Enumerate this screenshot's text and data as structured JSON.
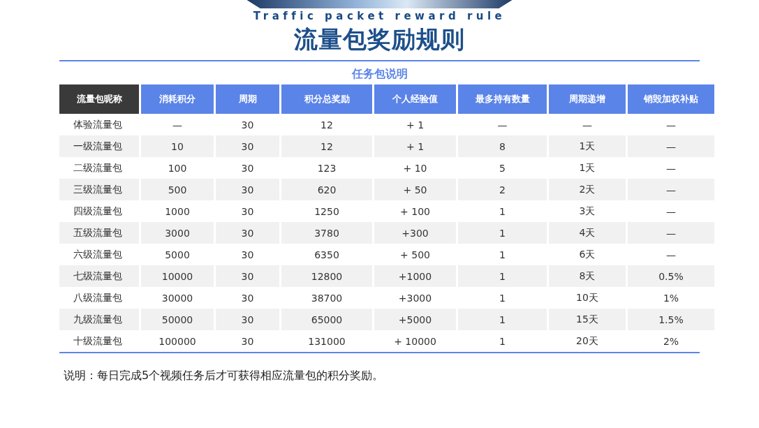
{
  "banner": {
    "subtitle": "Traffic packet reward rule",
    "title": "流量包奖励规则"
  },
  "section_title": "任务包说明",
  "table": {
    "columns": [
      {
        "label": "流量包昵称",
        "kind": "dark"
      },
      {
        "label": "消耗积分",
        "kind": "accent"
      },
      {
        "label": "周期",
        "kind": "accent"
      },
      {
        "label": "积分总奖励",
        "kind": "accent"
      },
      {
        "label": "个人经验值",
        "kind": "accent"
      },
      {
        "label": "最多持有数量",
        "kind": "accent"
      },
      {
        "label": "周期递增",
        "kind": "accent"
      },
      {
        "label": "销毁加权补贴",
        "kind": "accent"
      }
    ],
    "rows": [
      [
        "体验流量包",
        "—",
        "30",
        "12",
        "+ 1",
        "—",
        "—",
        "—"
      ],
      [
        "一级流量包",
        "10",
        "30",
        "12",
        "+ 1",
        "8",
        "1天",
        "—"
      ],
      [
        "二级流量包",
        "100",
        "30",
        "123",
        "+ 10",
        "5",
        "1天",
        "—"
      ],
      [
        "三级流量包",
        "500",
        "30",
        "620",
        "+ 50",
        "2",
        "2天",
        "—"
      ],
      [
        "四级流量包",
        "1000",
        "30",
        "1250",
        "+ 100",
        "1",
        "3天",
        "—"
      ],
      [
        "五级流量包",
        "3000",
        "30",
        "3780",
        "+300",
        "1",
        "4天",
        "—"
      ],
      [
        "六级流量包",
        "5000",
        "30",
        "6350",
        "+ 500",
        "1",
        "6天",
        "—"
      ],
      [
        "七级流量包",
        "10000",
        "30",
        "12800",
        "+1000",
        "1",
        "8天",
        "0.5%"
      ],
      [
        "八级流量包",
        "30000",
        "30",
        "38700",
        "+3000",
        "1",
        "10天",
        "1%"
      ],
      [
        "九级流量包",
        "50000",
        "30",
        "65000",
        "+5000",
        "1",
        "15天",
        "1.5%"
      ],
      [
        "十级流量包",
        "100000",
        "30",
        "131000",
        "+ 10000",
        "1",
        "20天",
        "2%"
      ]
    ]
  },
  "note": "说明：每日完成5个视频任务后才可获得相应流量包的积分奖励。"
}
